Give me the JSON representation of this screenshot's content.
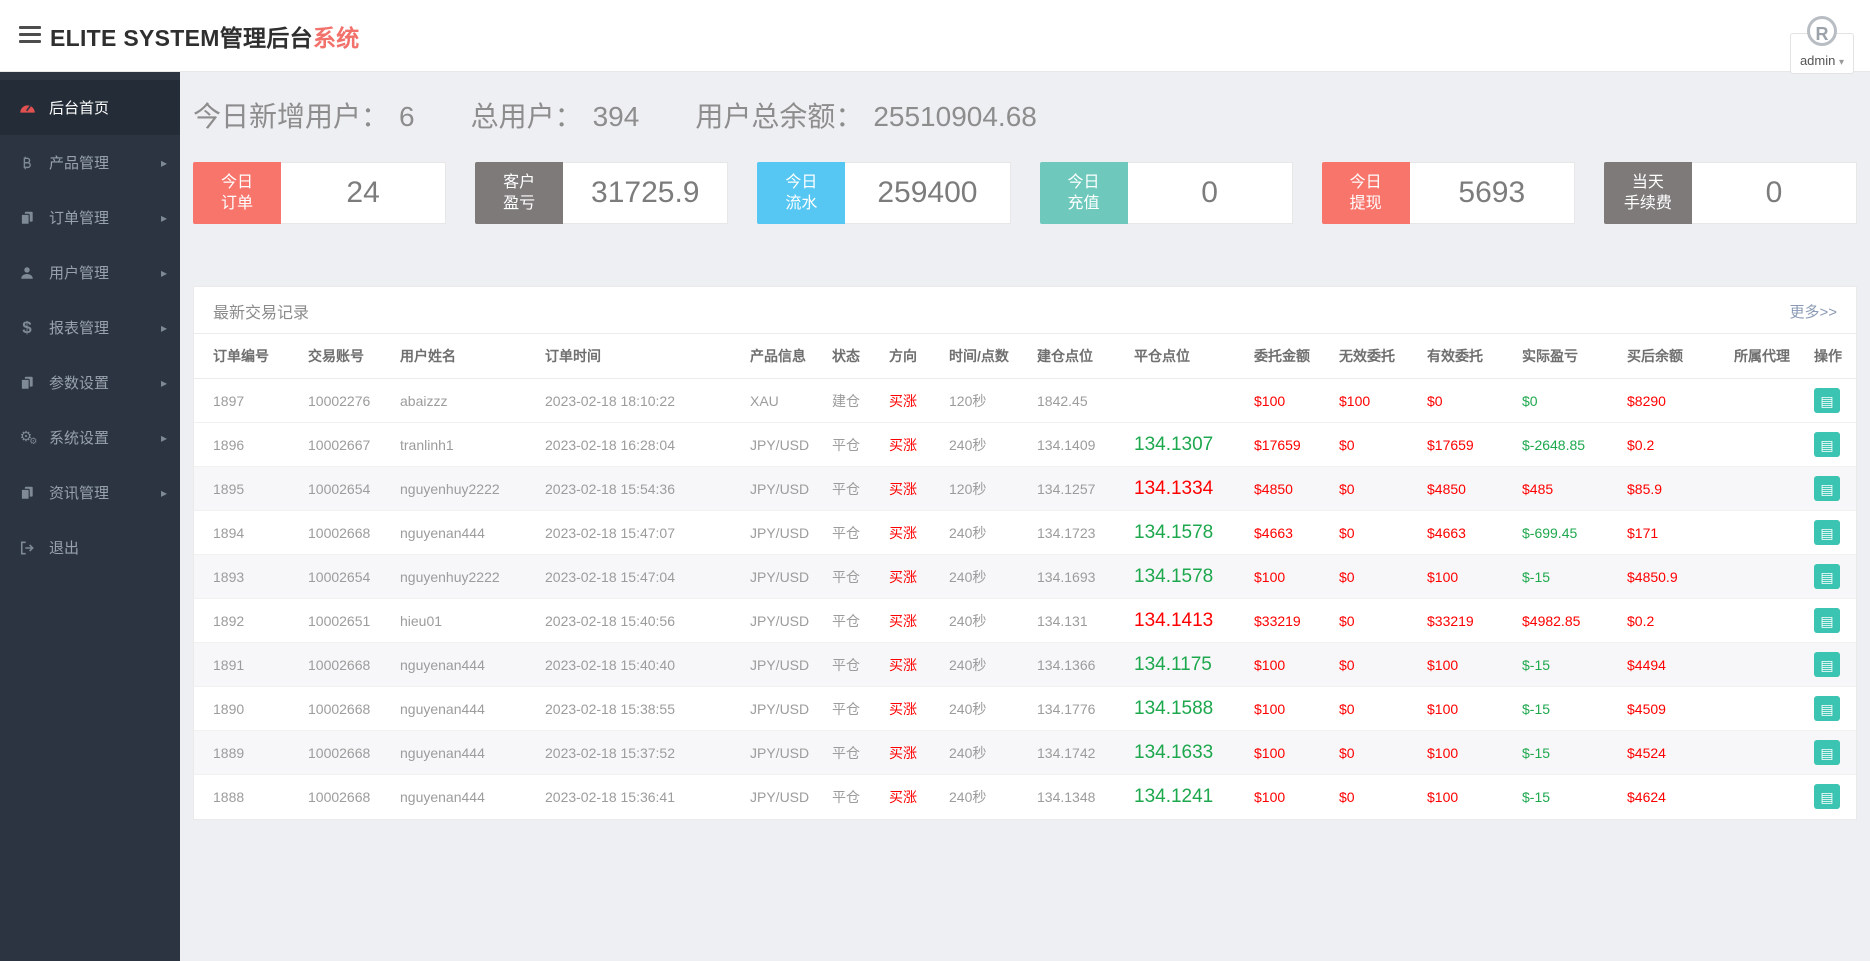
{
  "header": {
    "title_main": "ELITE SYSTEM管理后台",
    "title_accent": "系统",
    "user": "admin",
    "avatar_letter": "R"
  },
  "sidebar": {
    "items": [
      {
        "id": "home",
        "label": "后台首页",
        "icon": "dashboard-icon",
        "active": true,
        "has_submenu": false
      },
      {
        "id": "products",
        "label": "产品管理",
        "icon": "bitcoin-icon",
        "active": false,
        "has_submenu": true
      },
      {
        "id": "orders",
        "label": "订单管理",
        "icon": "files-icon",
        "active": false,
        "has_submenu": true
      },
      {
        "id": "users",
        "label": "用户管理",
        "icon": "user-icon",
        "active": false,
        "has_submenu": true
      },
      {
        "id": "reports",
        "label": "报表管理",
        "icon": "dollar-icon",
        "active": false,
        "has_submenu": true
      },
      {
        "id": "params",
        "label": "参数设置",
        "icon": "files-icon",
        "active": false,
        "has_submenu": true
      },
      {
        "id": "system",
        "label": "系统设置",
        "icon": "gears-icon",
        "active": false,
        "has_submenu": true
      },
      {
        "id": "news",
        "label": "资讯管理",
        "icon": "files-icon",
        "active": false,
        "has_submenu": true
      },
      {
        "id": "logout",
        "label": "退出",
        "icon": "logout-icon",
        "active": false,
        "has_submenu": false
      }
    ]
  },
  "summary": {
    "items": [
      {
        "id": "new_users",
        "label": "今日新增用户：",
        "value": "6"
      },
      {
        "id": "total_users",
        "label": "总用户：",
        "value": "394"
      },
      {
        "id": "total_balance",
        "label": "用户总余额：",
        "value": "25510904.68"
      }
    ]
  },
  "stat_cards": [
    {
      "id": "today_orders",
      "label_line1": "今日",
      "label_line2": "订单",
      "value": "24",
      "color": "#f8756c"
    },
    {
      "id": "customer_pnl",
      "label_line1": "客户",
      "label_line2": "盈亏",
      "value": "31725.9",
      "color": "#7d7a79"
    },
    {
      "id": "today_volume",
      "label_line1": "今日",
      "label_line2": "流水",
      "value": "259400",
      "color": "#55c7f2"
    },
    {
      "id": "today_deposit",
      "label_line1": "今日",
      "label_line2": "充值",
      "value": "0",
      "color": "#6ec9bc"
    },
    {
      "id": "today_withdraw",
      "label_line1": "今日",
      "label_line2": "提现",
      "value": "5693",
      "color": "#f8756c"
    },
    {
      "id": "today_fee",
      "label_line1": "当天",
      "label_line2": "手续费",
      "value": "0",
      "color": "#7d7a79"
    }
  ],
  "panel": {
    "title": "最新交易记录",
    "more_link": "更多>>"
  },
  "colors": {
    "accent_red": "#ff0000",
    "accent_green": "#1ea84e",
    "action_teal": "#3ac4b1",
    "sidebar_bg": "#2b3440"
  },
  "table": {
    "headers": [
      "订单编号",
      "交易账号",
      "用户姓名",
      "订单时间",
      "产品信息",
      "状态",
      "方向",
      "时间/点数",
      "建仓点位",
      "平仓点位",
      "委托金额",
      "无效委托",
      "有效委托",
      "实际盈亏",
      "买后余额",
      "所属代理",
      "操作"
    ],
    "rows": [
      {
        "order_id": "1897",
        "account": "10002276",
        "name": "abaizzz",
        "time": "2023-02-18 18:10:22",
        "product": "XAU",
        "status": "建仓",
        "direction": "买涨",
        "duration": "120秒",
        "open": "1842.45",
        "close": "",
        "close_color": "",
        "amount": "$100",
        "invalid": "$100",
        "valid": "$0",
        "profit": "$0",
        "profit_color": "green",
        "balance": "$8290",
        "agent": ""
      },
      {
        "order_id": "1896",
        "account": "10002667",
        "name": "tranlinh1",
        "time": "2023-02-18 16:28:04",
        "product": "JPY/USD",
        "status": "平仓",
        "direction": "买涨",
        "duration": "240秒",
        "open": "134.1409",
        "close": "134.1307",
        "close_color": "green",
        "amount": "$17659",
        "invalid": "$0",
        "valid": "$17659",
        "profit": "$-2648.85",
        "profit_color": "green",
        "balance": "$0.2",
        "agent": ""
      },
      {
        "order_id": "1895",
        "account": "10002654",
        "name": "nguyenhuy2222",
        "time": "2023-02-18 15:54:36",
        "product": "JPY/USD",
        "status": "平仓",
        "direction": "买涨",
        "duration": "120秒",
        "open": "134.1257",
        "close": "134.1334",
        "close_color": "red",
        "amount": "$4850",
        "invalid": "$0",
        "valid": "$4850",
        "profit": "$485",
        "profit_color": "red",
        "balance": "$85.9",
        "agent": ""
      },
      {
        "order_id": "1894",
        "account": "10002668",
        "name": "nguyenan444",
        "time": "2023-02-18 15:47:07",
        "product": "JPY/USD",
        "status": "平仓",
        "direction": "买涨",
        "duration": "240秒",
        "open": "134.1723",
        "close": "134.1578",
        "close_color": "green",
        "amount": "$4663",
        "invalid": "$0",
        "valid": "$4663",
        "profit": "$-699.45",
        "profit_color": "green",
        "balance": "$171",
        "agent": ""
      },
      {
        "order_id": "1893",
        "account": "10002654",
        "name": "nguyenhuy2222",
        "time": "2023-02-18 15:47:04",
        "product": "JPY/USD",
        "status": "平仓",
        "direction": "买涨",
        "duration": "240秒",
        "open": "134.1693",
        "close": "134.1578",
        "close_color": "green",
        "amount": "$100",
        "invalid": "$0",
        "valid": "$100",
        "profit": "$-15",
        "profit_color": "green",
        "balance": "$4850.9",
        "agent": ""
      },
      {
        "order_id": "1892",
        "account": "10002651",
        "name": "hieu01",
        "time": "2023-02-18 15:40:56",
        "product": "JPY/USD",
        "status": "平仓",
        "direction": "买涨",
        "duration": "240秒",
        "open": "134.131",
        "close": "134.1413",
        "close_color": "red",
        "amount": "$33219",
        "invalid": "$0",
        "valid": "$33219",
        "profit": "$4982.85",
        "profit_color": "red",
        "balance": "$0.2",
        "agent": ""
      },
      {
        "order_id": "1891",
        "account": "10002668",
        "name": "nguyenan444",
        "time": "2023-02-18 15:40:40",
        "product": "JPY/USD",
        "status": "平仓",
        "direction": "买涨",
        "duration": "240秒",
        "open": "134.1366",
        "close": "134.1175",
        "close_color": "green",
        "amount": "$100",
        "invalid": "$0",
        "valid": "$100",
        "profit": "$-15",
        "profit_color": "green",
        "balance": "$4494",
        "agent": ""
      },
      {
        "order_id": "1890",
        "account": "10002668",
        "name": "nguyenan444",
        "time": "2023-02-18 15:38:55",
        "product": "JPY/USD",
        "status": "平仓",
        "direction": "买涨",
        "duration": "240秒",
        "open": "134.1776",
        "close": "134.1588",
        "close_color": "green",
        "amount": "$100",
        "invalid": "$0",
        "valid": "$100",
        "profit": "$-15",
        "profit_color": "green",
        "balance": "$4509",
        "agent": ""
      },
      {
        "order_id": "1889",
        "account": "10002668",
        "name": "nguyenan444",
        "time": "2023-02-18 15:37:52",
        "product": "JPY/USD",
        "status": "平仓",
        "direction": "买涨",
        "duration": "240秒",
        "open": "134.1742",
        "close": "134.1633",
        "close_color": "green",
        "amount": "$100",
        "invalid": "$0",
        "valid": "$100",
        "profit": "$-15",
        "profit_color": "green",
        "balance": "$4524",
        "agent": ""
      },
      {
        "order_id": "1888",
        "account": "10002668",
        "name": "nguyenan444",
        "time": "2023-02-18 15:36:41",
        "product": "JPY/USD",
        "status": "平仓",
        "direction": "买涨",
        "duration": "240秒",
        "open": "134.1348",
        "close": "134.1241",
        "close_color": "green",
        "amount": "$100",
        "invalid": "$0",
        "valid": "$100",
        "profit": "$-15",
        "profit_color": "green",
        "balance": "$4624",
        "agent": ""
      }
    ]
  }
}
